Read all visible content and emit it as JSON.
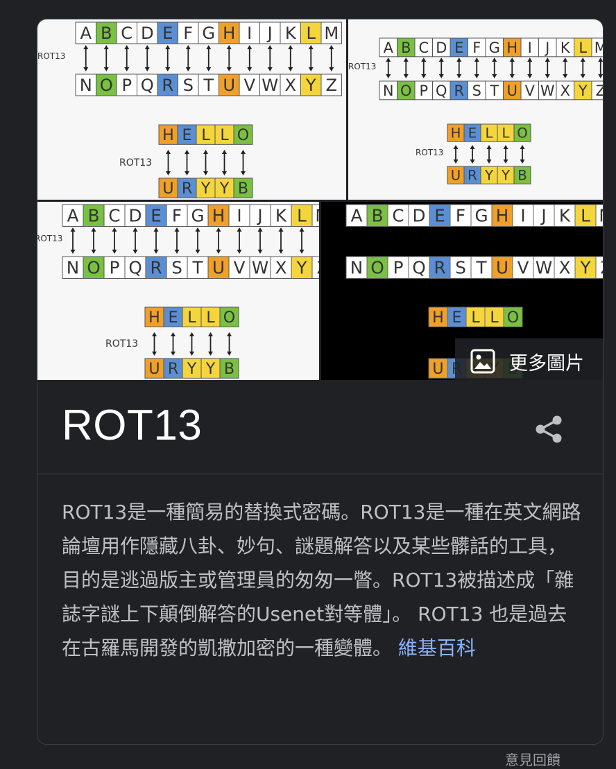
{
  "rot13_image": {
    "top_row": [
      "A",
      "B",
      "C",
      "D",
      "E",
      "F",
      "G",
      "H",
      "I",
      "J",
      "K",
      "L",
      "M"
    ],
    "bottom_row": [
      "N",
      "O",
      "P",
      "Q",
      "R",
      "S",
      "T",
      "U",
      "V",
      "W",
      "X",
      "Y",
      "Z"
    ],
    "label": "ROT13",
    "word_top": [
      "H",
      "E",
      "L",
      "L",
      "O"
    ],
    "word_bottom": [
      "U",
      "R",
      "Y",
      "Y",
      "B"
    ],
    "colors": {
      "green": "#7ac043",
      "blue": "#5b8fd4",
      "orange": "#f0a028",
      "yellow": "#f5d53c",
      "white": "#ffffff"
    }
  },
  "more_images": {
    "label": "更多圖片",
    "icon": "image-icon"
  },
  "entity": {
    "title": "ROT13",
    "share_icon": "share-icon"
  },
  "description": {
    "text": "ROT13是一種簡易的替換式密碼。ROT13是一種在英文網路論壇用作隱藏八卦、妙句、謎題解答以及某些髒話的工具，目的是逃過版主或管理員的匆匆一瞥。ROT13被描述成「雜誌字謎上下顛倒解答的Usenet對等體」。 ROT13 也是過去在古羅馬開發的凱撒加密的一種變體。",
    "source_link": "維基百科"
  },
  "feedback": {
    "label": "意見回饋"
  }
}
